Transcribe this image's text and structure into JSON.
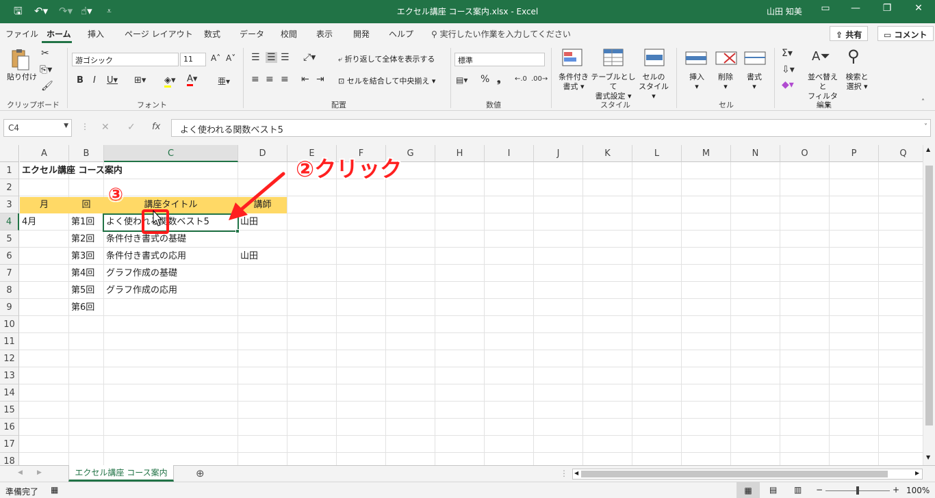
{
  "window": {
    "title": "エクセル講座 コース案内.xlsx  -  Excel",
    "user": "山田 知美"
  },
  "tabs": [
    "ファイル",
    "ホーム",
    "挿入",
    "ページ レイアウト",
    "数式",
    "データ",
    "校閲",
    "表示",
    "開発",
    "ヘルプ"
  ],
  "active_tab": "ホーム",
  "tell_me": "実行したい作業を入力してください",
  "share_label": "共有",
  "comment_label": "コメント",
  "ribbon": {
    "clipboard": {
      "paste": "貼り付け",
      "group": "クリップボード"
    },
    "font": {
      "name": "游ゴシック",
      "size": "11",
      "group": "フォント"
    },
    "alignment": {
      "wrap": "折り返して全体を表示する",
      "merge": "セルを結合して中央揃え",
      "group": "配置"
    },
    "number": {
      "format": "標準",
      "group": "数値"
    },
    "styles": {
      "conditional": "条件付き",
      "conditional2": "書式",
      "table": "テーブルとして",
      "table2": "書式設定",
      "cellstyle": "セルの",
      "cellstyle2": "スタイル",
      "group": "スタイル"
    },
    "cells": {
      "insert": "挿入",
      "delete": "削除",
      "format": "書式",
      "group": "セル"
    },
    "editing": {
      "sort": "並べ替えと",
      "sort2": "フィルター",
      "find": "検索と",
      "find2": "選択",
      "group": "編集"
    }
  },
  "formula_bar": {
    "name_box": "C4",
    "formula": "よく使われる関数ベスト5"
  },
  "columns": [
    "A",
    "B",
    "C",
    "D",
    "E",
    "F",
    "G",
    "H",
    "I",
    "J",
    "K",
    "L",
    "M",
    "N",
    "O",
    "P",
    "Q"
  ],
  "rows": [
    "1",
    "2",
    "3",
    "4",
    "5",
    "6",
    "7",
    "8",
    "9",
    "10",
    "11",
    "12",
    "13",
    "14",
    "15",
    "16",
    "17",
    "18"
  ],
  "cells": {
    "A1": "エクセル講座 コース案内",
    "A3": "月",
    "B3": "回",
    "C3": "講座タイトル",
    "D3": "講師",
    "A4": "4月",
    "B4": "第1回",
    "C4": "よく使われる関数ベスト5",
    "D4": "山田",
    "B5": "第2回",
    "C5": "条件付き書式の基礎",
    "B6": "第3回",
    "C6": "条件付き書式の応用",
    "D6": "山田",
    "B7": "第4回",
    "C7": "グラフ作成の基礎",
    "B8": "第5回",
    "C8": "グラフ作成の応用",
    "B9": "第6回"
  },
  "sheet_tab": "エクセル講座 コース案内",
  "status": {
    "ready": "準備完了",
    "zoom": "100%"
  },
  "annotations": {
    "click_label": "②クリック",
    "step3": "③"
  },
  "colors": {
    "excel_green": "#217346",
    "header_fill": "#ffd966",
    "annotation_red": "#ff2020"
  }
}
